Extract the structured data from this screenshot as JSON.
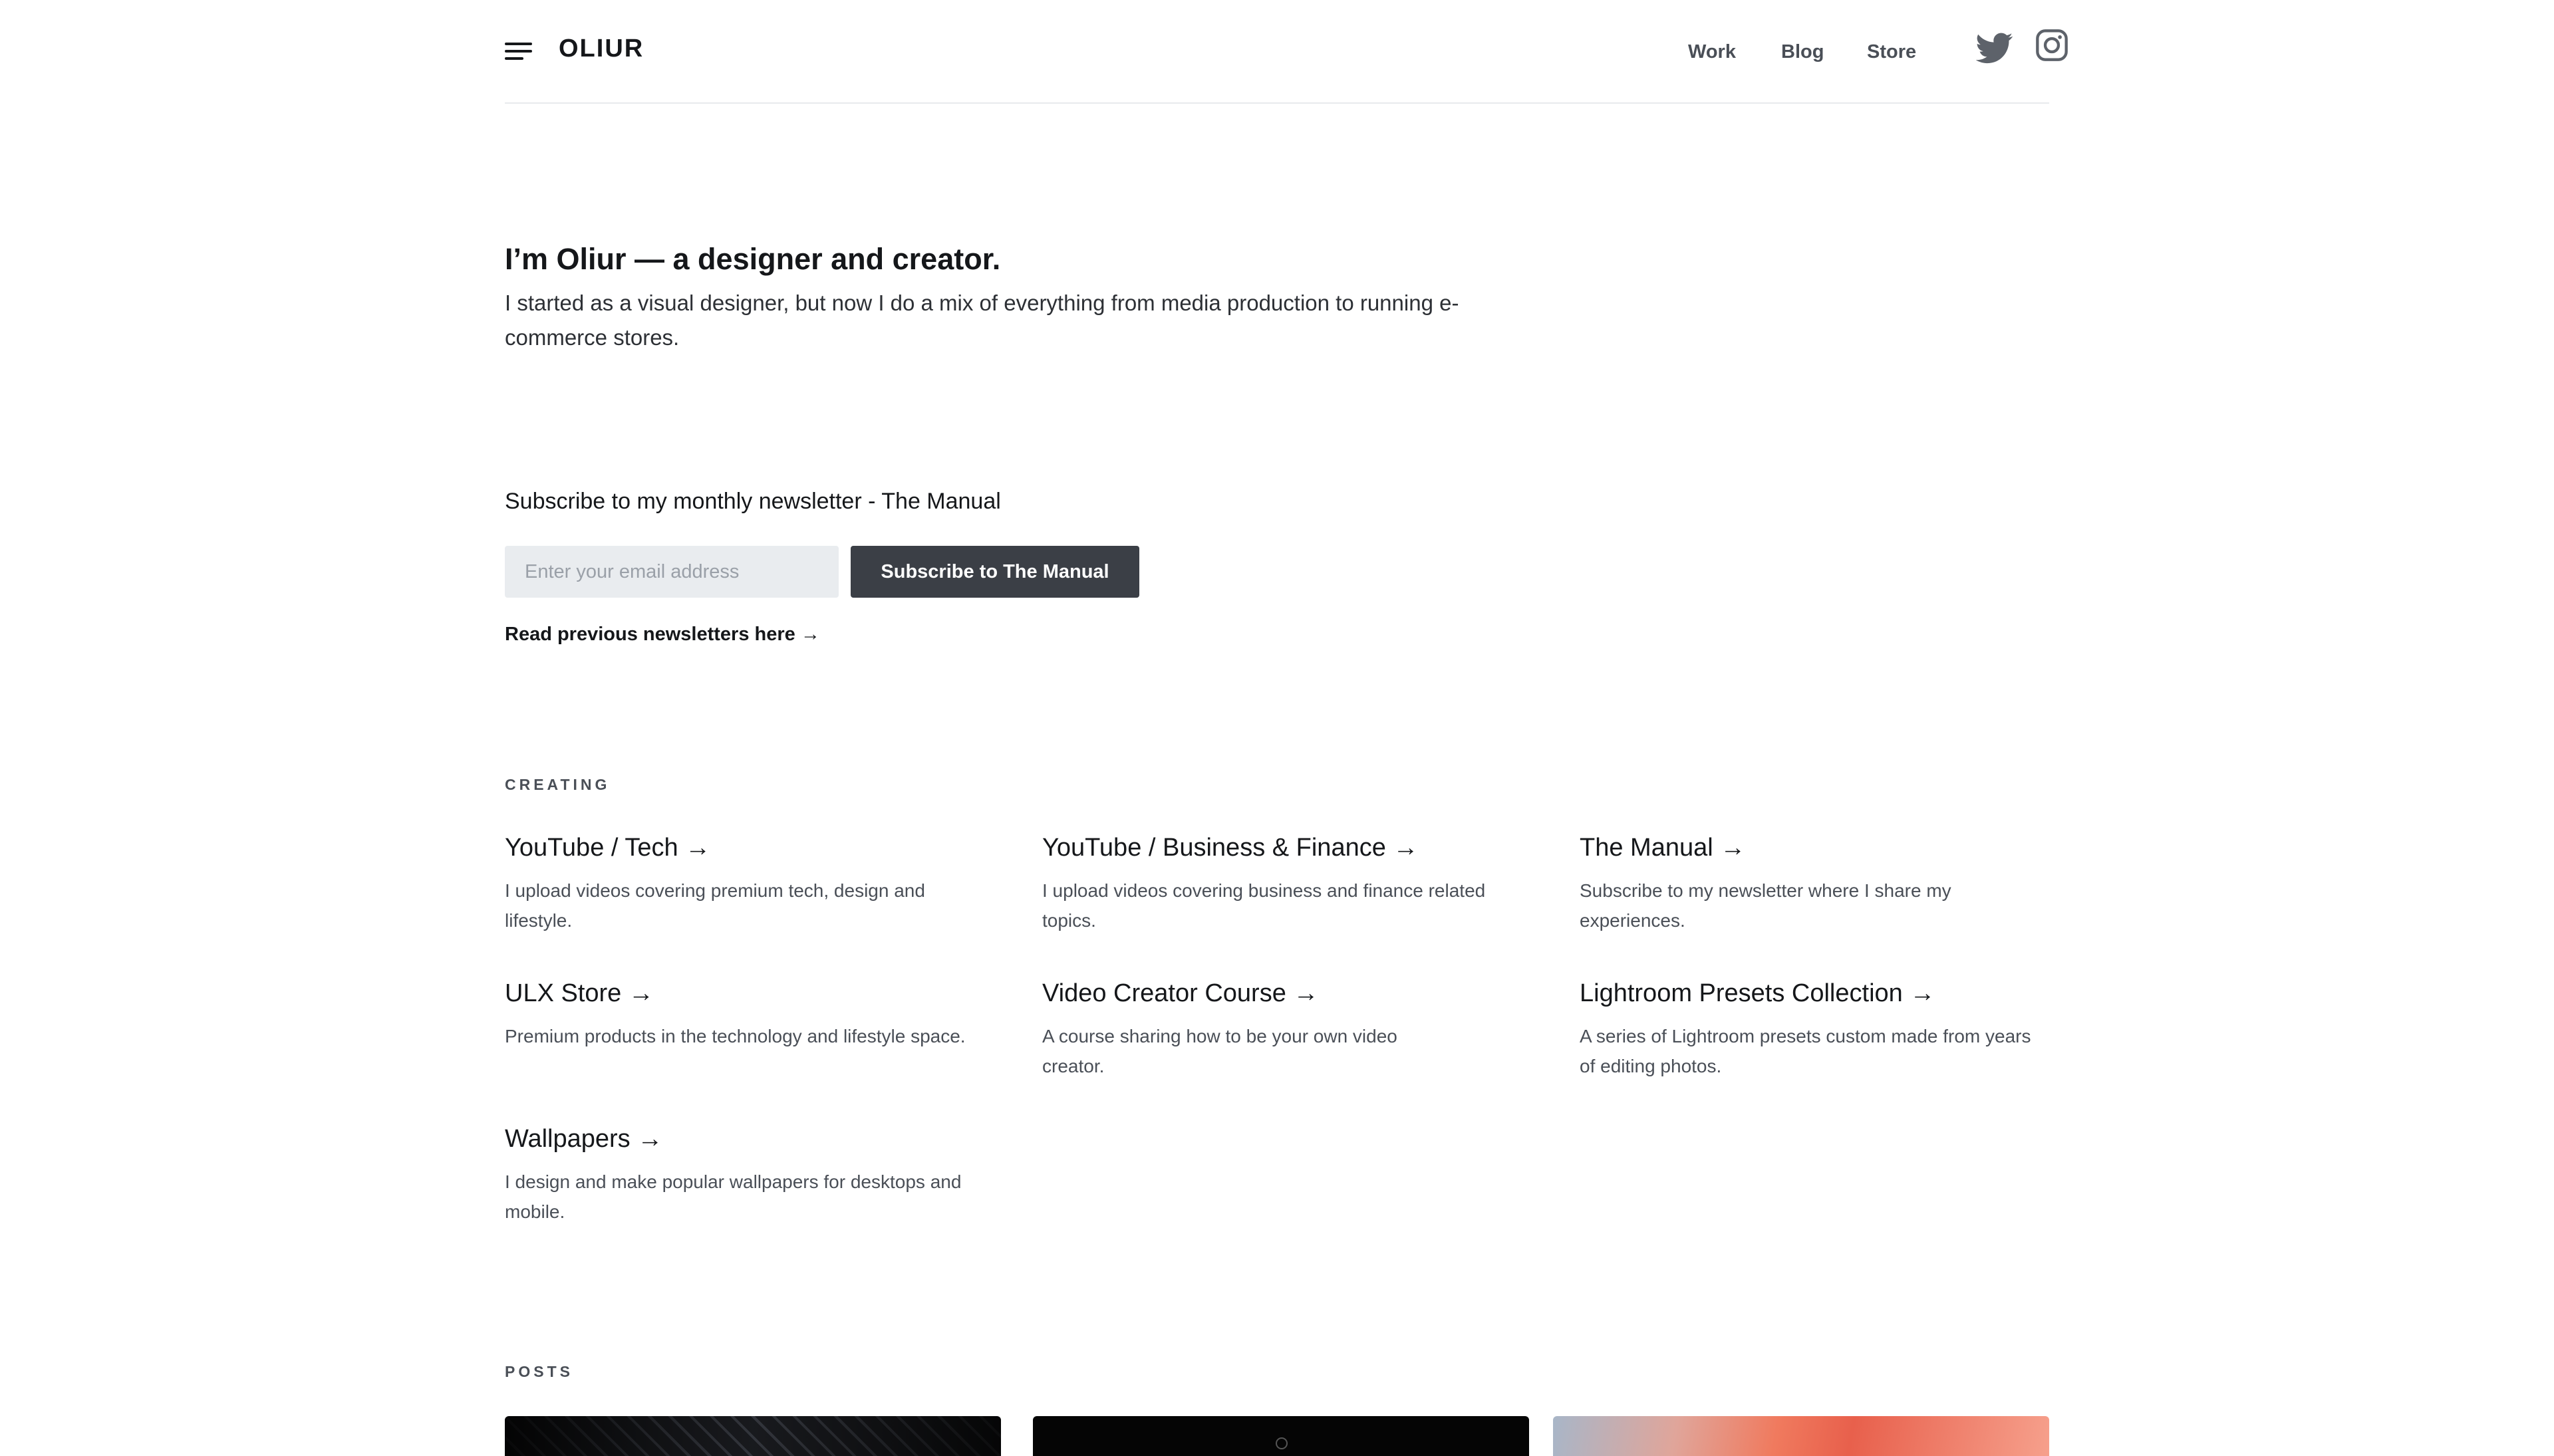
{
  "header": {
    "logo": "OLIUR",
    "nav": [
      "Work",
      "Blog",
      "Store"
    ],
    "icons": [
      "menu-icon",
      "twitter-icon",
      "instagram-icon"
    ]
  },
  "hero": {
    "title": "I’m Oliur — a designer and creator.",
    "text": "I started as a visual designer, but now I do a mix of everything from media production to running e-commerce stores."
  },
  "newsletter": {
    "heading": "Subscribe to my monthly newsletter - The Manual",
    "placeholder": "Enter your email address",
    "button": "Subscribe to The Manual",
    "link": "Read previous newsletters here →"
  },
  "creating": {
    "label": "CREATING",
    "items": [
      {
        "title": "YouTube / Tech →",
        "desc": "I upload videos covering premium tech, design and lifestyle."
      },
      {
        "title": "YouTube / Business & Finance →",
        "desc": "I upload videos covering business and finance related topics."
      },
      {
        "title": "The Manual →",
        "desc": "Subscribe to my newsletter where I share my experiences."
      },
      {
        "title": "ULX Store →",
        "desc": "Premium products in the technology and lifestyle space."
      },
      {
        "title": "Video Creator Course →",
        "desc": "A course sharing how to be your own video creator."
      },
      {
        "title": "Lightroom Presets Collection →",
        "desc": "A series of Lightroom presets custom made from years of editing photos."
      },
      {
        "title": "Wallpapers →",
        "desc": "I design and make popular wallpapers for desktops and mobile."
      }
    ]
  },
  "posts": {
    "label": "POSTS"
  },
  "colors": {
    "text": "#15171a",
    "muted": "#4a4f57",
    "button_bg": "#3b3f46",
    "input_bg": "#e9ecef",
    "divider": "#e8eaed"
  }
}
